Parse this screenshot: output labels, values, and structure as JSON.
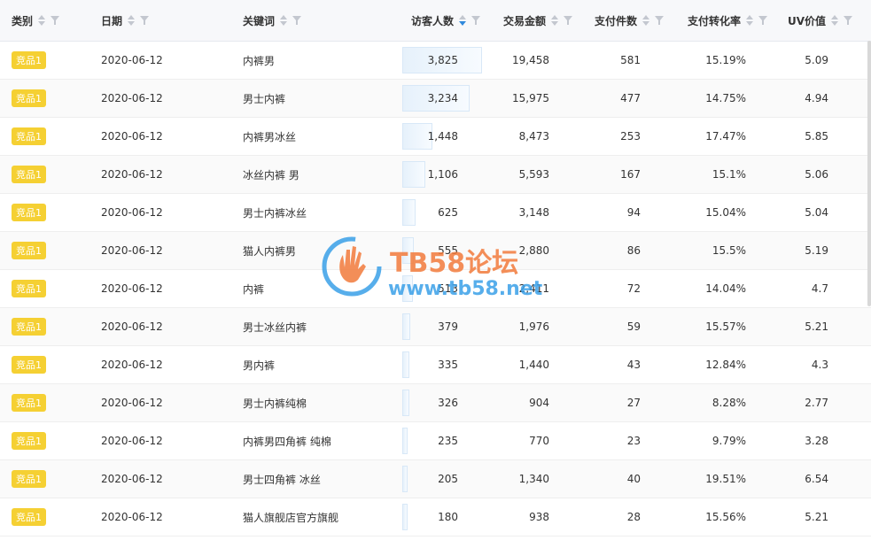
{
  "columns": [
    {
      "key": "category",
      "label": "类别"
    },
    {
      "key": "date",
      "label": "日期"
    },
    {
      "key": "keyword",
      "label": "关键词"
    },
    {
      "key": "visitors",
      "label": "访客人数"
    },
    {
      "key": "amount",
      "label": "交易金额"
    },
    {
      "key": "orders",
      "label": "支付件数"
    },
    {
      "key": "conversion",
      "label": "支付转化率"
    },
    {
      "key": "uv",
      "label": "UV价值"
    }
  ],
  "sort": {
    "column": "访客人数",
    "direction": "descending"
  },
  "colors": {
    "tag": "#f5d033",
    "sort_active": "#3089dc"
  },
  "rows": [
    {
      "category": "竞品1",
      "date": "2020-06-12",
      "keyword": "内裤男",
      "visitors": "3,825",
      "visitors_value": 3825,
      "amount": "19,458",
      "orders": "581",
      "conversion": "15.19%",
      "uv": "5.09"
    },
    {
      "category": "竞品1",
      "date": "2020-06-12",
      "keyword": "男士内裤",
      "visitors": "3,234",
      "visitors_value": 3234,
      "amount": "15,975",
      "orders": "477",
      "conversion": "14.75%",
      "uv": "4.94"
    },
    {
      "category": "竞品1",
      "date": "2020-06-12",
      "keyword": "内裤男冰丝",
      "visitors": "1,448",
      "visitors_value": 1448,
      "amount": "8,473",
      "orders": "253",
      "conversion": "17.47%",
      "uv": "5.85"
    },
    {
      "category": "竞品1",
      "date": "2020-06-12",
      "keyword": "冰丝内裤 男",
      "visitors": "1,106",
      "visitors_value": 1106,
      "amount": "5,593",
      "orders": "167",
      "conversion": "15.1%",
      "uv": "5.06"
    },
    {
      "category": "竞品1",
      "date": "2020-06-12",
      "keyword": "男士内裤冰丝",
      "visitors": "625",
      "visitors_value": 625,
      "amount": "3,148",
      "orders": "94",
      "conversion": "15.04%",
      "uv": "5.04"
    },
    {
      "category": "竞品1",
      "date": "2020-06-12",
      "keyword": "猫人内裤男",
      "visitors": "555",
      "visitors_value": 555,
      "amount": "2,880",
      "orders": "86",
      "conversion": "15.5%",
      "uv": "5.19"
    },
    {
      "category": "竞品1",
      "date": "2020-06-12",
      "keyword": "内裤",
      "visitors": "513",
      "visitors_value": 513,
      "amount": "2,411",
      "orders": "72",
      "conversion": "14.04%",
      "uv": "4.7"
    },
    {
      "category": "竞品1",
      "date": "2020-06-12",
      "keyword": "男士冰丝内裤",
      "visitors": "379",
      "visitors_value": 379,
      "amount": "1,976",
      "orders": "59",
      "conversion": "15.57%",
      "uv": "5.21"
    },
    {
      "category": "竞品1",
      "date": "2020-06-12",
      "keyword": "男内裤",
      "visitors": "335",
      "visitors_value": 335,
      "amount": "1,440",
      "orders": "43",
      "conversion": "12.84%",
      "uv": "4.3"
    },
    {
      "category": "竞品1",
      "date": "2020-06-12",
      "keyword": "男士内裤纯棉",
      "visitors": "326",
      "visitors_value": 326,
      "amount": "904",
      "orders": "27",
      "conversion": "8.28%",
      "uv": "2.77"
    },
    {
      "category": "竞品1",
      "date": "2020-06-12",
      "keyword": "内裤男四角裤 纯棉",
      "visitors": "235",
      "visitors_value": 235,
      "amount": "770",
      "orders": "23",
      "conversion": "9.79%",
      "uv": "3.28"
    },
    {
      "category": "竞品1",
      "date": "2020-06-12",
      "keyword": "男士四角裤 冰丝",
      "visitors": "205",
      "visitors_value": 205,
      "amount": "1,340",
      "orders": "40",
      "conversion": "19.51%",
      "uv": "6.54"
    },
    {
      "category": "竞品1",
      "date": "2020-06-12",
      "keyword": "猫人旗舰店官方旗舰",
      "visitors": "180",
      "visitors_value": 180,
      "amount": "938",
      "orders": "28",
      "conversion": "15.56%",
      "uv": "5.21"
    }
  ],
  "watermark": {
    "title": "TB58论坛",
    "url": "www.tb58.net"
  }
}
